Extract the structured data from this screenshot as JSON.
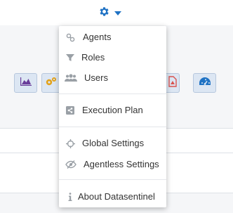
{
  "header": {
    "settings_icon": "gear-icon",
    "caret_icon": "caret-down-icon",
    "accent": "#1f72c4"
  },
  "toolbar": {
    "buttons": [
      {
        "icon": "area-chart-icon",
        "color": "#6a3d9a"
      },
      {
        "icon": "gears-icon",
        "color": "#e3a21a"
      },
      {
        "icon": "pdf-icon",
        "color": "#d9534f"
      },
      {
        "icon": "dashboard-icon",
        "color": "#1f72c4"
      }
    ]
  },
  "settings_menu": {
    "items": [
      {
        "label": "Agents",
        "icon": "link-icon"
      },
      {
        "label": "Roles",
        "icon": "filter-icon"
      },
      {
        "label": "Users",
        "icon": "users-icon"
      },
      {
        "label": "Execution Plan",
        "icon": "share-icon"
      },
      {
        "label": "Global Settings",
        "icon": "crosshairs-icon"
      },
      {
        "label": "Agentless Settings",
        "icon": "eye-slash-icon"
      },
      {
        "label": "About Datasentinel",
        "icon": "info-icon"
      }
    ]
  }
}
